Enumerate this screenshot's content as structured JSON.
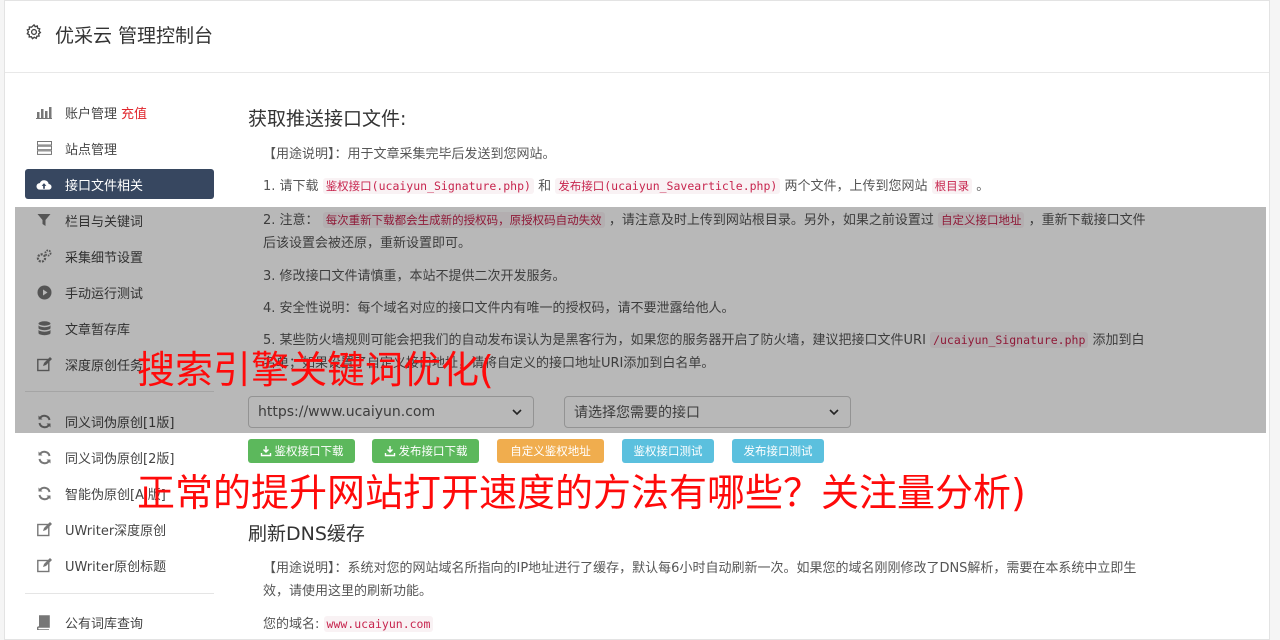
{
  "header": {
    "title": "优采云 管理控制台"
  },
  "sidebar": {
    "items": [
      {
        "label": "账户管理",
        "extra": "充值",
        "icon": "bar-chart-icon"
      },
      {
        "label": "站点管理",
        "icon": "server-icon"
      },
      {
        "label": "接口文件相关",
        "icon": "cloud-upload-icon",
        "active": true
      },
      {
        "label": "栏目与关键词",
        "icon": "filter-icon"
      },
      {
        "label": "采集细节设置",
        "icon": "cogs-icon"
      },
      {
        "label": "手动运行测试",
        "icon": "play-circle-icon"
      },
      {
        "label": "文章暂存库",
        "icon": "database-icon"
      },
      {
        "label": "深度原创任务",
        "icon": "edit-icon"
      },
      {
        "label": "同义词伪原创[1版]",
        "icon": "refresh-icon"
      },
      {
        "label": "同义词伪原创[2版]",
        "icon": "refresh-icon"
      },
      {
        "label": "智能伪原创[AI版]",
        "icon": "refresh-icon"
      },
      {
        "label": "UWriter深度原创",
        "icon": "edit-icon"
      },
      {
        "label": "UWriter原创标题",
        "icon": "edit-icon"
      },
      {
        "label": "公有词库查询",
        "icon": "book-icon"
      }
    ]
  },
  "section1": {
    "title": "获取推送接口文件:",
    "usage": "【用途说明】：用于文章采集完毕后发送到您网站。",
    "step1": {
      "prefix": "1. 请下载",
      "code1": "鉴权接口(ucaiyun_Signature.php)",
      "and": "和",
      "code2": "发布接口(ucaiyun_Savearticle.php)",
      "mid": "两个文件，上传到您网站",
      "code3": "根目录",
      "end": "。"
    },
    "step2": {
      "prefix": "2. 注意：",
      "code1": "每次重新下载都会生成新的授权码，原授权码自动失效",
      "mid": "，请注意及时上传到网站根目录。另外，如果之前设置过",
      "code2": "自定义接口地址",
      "end": "，重新下载接口文件后该设置会被还原，重新设置即可。"
    },
    "step3": "3. 修改接口文件请慎重，本站不提供二次开发服务。",
    "step4": "4. 安全性说明：每个域名对应的接口文件内有唯一的授权码，请不要泄露给他人。",
    "step5": {
      "prefix": "5. 某些防火墙规则可能会把我们的自动发布误认为是黑客行为，如果您的服务器开启了防火墙，建议把接口文件URI",
      "code1": "/ucaiyun_Signature.php",
      "mid": "添加到白名单；如果设置了自定义接口地址，请将自定义的接口地址URI添加到白名单。"
    },
    "site_select": "https://www.ucaiyun.com",
    "api_select": "请选择您需要的接口",
    "buttons": {
      "download_sign": "鉴权接口下载",
      "download_publish": "发布接口下载",
      "custom_sign": "自定义鉴权地址",
      "test_sign": "鉴权接口测试",
      "test_publish": "发布接口测试"
    }
  },
  "section2": {
    "title": "刷新DNS缓存",
    "usage": "【用途说明】：系统对您的网站域名所指向的IP地址进行了缓存，默认每6小时自动刷新一次。如果您的域名刚刚修改了DNS解析，需要在本系统中立即生效，请使用这里的刷新功能。",
    "domain_label": "您的域名:",
    "domain_value": "www.ucaiyun.com"
  },
  "banner": {
    "line1": "搜索引擎关键词优化(",
    "line2": "正常的提升网站打开速度的方法有哪些？关注量分析)"
  },
  "colors": {
    "active_nav": "#374760",
    "red": "#e0242b",
    "code": "#c7254e",
    "btn_green": "#5cb85c",
    "btn_orange": "#f0ad4e",
    "btn_blue": "#5bc0de",
    "banner_red": "#ff0a0a"
  }
}
